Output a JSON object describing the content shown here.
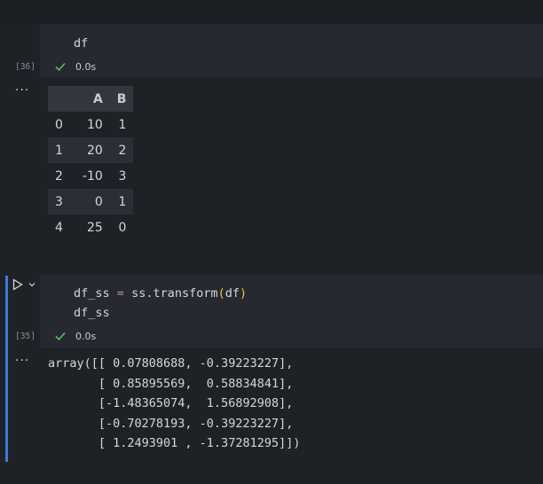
{
  "cell1": {
    "code": "df",
    "exec_count": "[36]",
    "status_time": "0.0s",
    "output_more": "···",
    "dataframe": {
      "columns": [
        "A",
        "B"
      ],
      "rows": [
        {
          "index": "0",
          "A": "10",
          "B": "1"
        },
        {
          "index": "1",
          "A": "20",
          "B": "2"
        },
        {
          "index": "2",
          "A": "-10",
          "B": "3"
        },
        {
          "index": "3",
          "A": "0",
          "B": "1"
        },
        {
          "index": "4",
          "A": "25",
          "B": "0"
        }
      ]
    }
  },
  "cell2": {
    "code_line1_var": "df_ss",
    "code_line1_op": "=",
    "code_line1_call": "ss.transform",
    "code_line1_paren_open": "(",
    "code_line1_arg": "df",
    "code_line1_paren_close": ")",
    "code_line2": "df_ss",
    "exec_count": "[35]",
    "status_time": "0.0s",
    "output_more": "···",
    "output_lines": [
      "array([[ 0.07808688, -0.39223227],",
      "       [ 0.85895569,  0.58834841],",
      "       [-1.48365074,  1.56892908],",
      "       [-0.70278193, -0.39223227],",
      "       [ 1.2493901 , -1.37281295]])"
    ]
  },
  "colors": {
    "background": "#1e2227",
    "cell_background": "#262a30",
    "active_bar": "#3f7bd9",
    "success_check": "#4ec26a",
    "paren": "#f0c14a",
    "operator": "#c586c0"
  }
}
